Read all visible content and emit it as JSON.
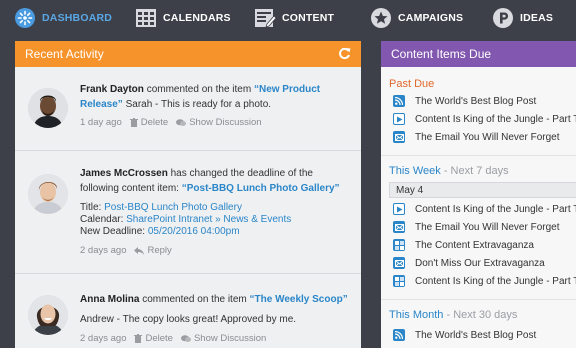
{
  "nav": {
    "items": [
      {
        "label": "DASHBOARD",
        "icon": "dashboard-icon"
      },
      {
        "label": "CALENDARS",
        "icon": "calendar-icon"
      },
      {
        "label": "CONTENT",
        "icon": "content-icon"
      },
      {
        "label": "CAMPAIGNS",
        "icon": "star-icon"
      },
      {
        "label": "IDEAS",
        "icon": "ideas-icon"
      }
    ]
  },
  "recent": {
    "title": "Recent Activity",
    "entries": [
      {
        "name": "Frank Dayton",
        "action": "commented on the item",
        "item": "“New Product Release”",
        "comment": "Sarah - This is ready for a photo.",
        "time": "1 day ago",
        "delete": "Delete",
        "show": "Show Discussion"
      },
      {
        "name": "James McCrossen",
        "action": "has changed the deadline of the following content item:",
        "item": "“Post-BBQ Lunch Photo Gallery”",
        "title_label": "Title:",
        "title_value": "Post-BBQ Lunch Photo Gallery",
        "calendar_label": "Calendar:",
        "calendar_value": "SharePoint Intranet » News & Events",
        "deadline_label": "New Deadline:",
        "deadline_value": "05/20/2016 04:00pm",
        "time": "2 days ago",
        "reply": "Reply"
      },
      {
        "name": "Anna Molina",
        "action": "commented on the item",
        "item": "“The Weekly Scoop”",
        "comment": "Andrew - The copy looks great! Approved by me.",
        "time": "2 days ago",
        "delete": "Delete",
        "show": "Show Discussion"
      }
    ]
  },
  "due": {
    "title": "Content Items Due",
    "past_due": {
      "label": "Past Due",
      "items": [
        {
          "text": "The World's Best Blog Post",
          "type": "rss"
        },
        {
          "text": "Content Is King of the Jungle - Part Tw",
          "type": "video"
        },
        {
          "text": "The Email You Will Never Forget",
          "type": "email"
        }
      ]
    },
    "this_week": {
      "label": "This Week",
      "sub": " - Next 7 days",
      "date": "May 4",
      "items": [
        {
          "text": "Content Is King of the Jungle - Part Tw",
          "type": "video"
        },
        {
          "text": "The Email You Will Never Forget",
          "type": "email"
        },
        {
          "text": "The Content Extravaganza",
          "type": "event"
        },
        {
          "text": "Don't Miss Our Extravaganza",
          "type": "email"
        },
        {
          "text": "Content Is King of the Jungle - Part Tw",
          "type": "event"
        }
      ]
    },
    "this_month": {
      "label": "This Month",
      "sub": " - Next 30 days",
      "items": [
        {
          "text": "The World's Best Blog Post",
          "type": "rss"
        }
      ]
    }
  }
}
